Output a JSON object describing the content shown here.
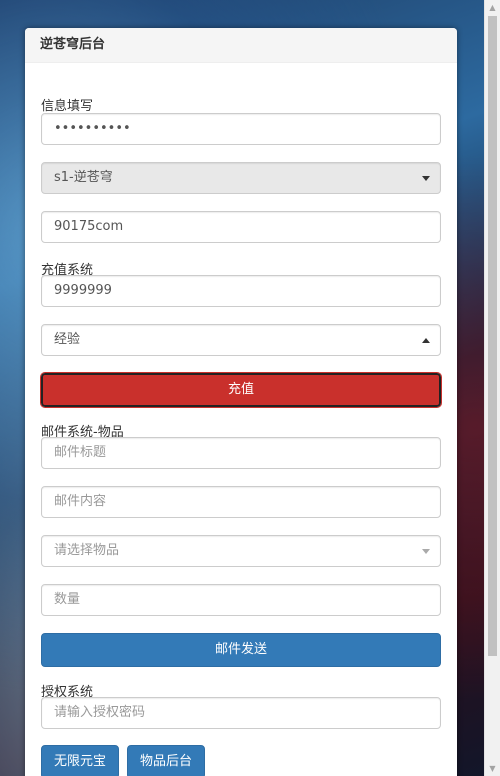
{
  "panel": {
    "title": "逆苍穹后台"
  },
  "info": {
    "label": "信息填写",
    "password_value": "••••••••••",
    "server_selected": "s1-逆苍穹",
    "account_value": "90175com"
  },
  "recharge": {
    "label": "充值系统",
    "amount_value": "9999999",
    "type_selected": "经验",
    "button_label": "充值"
  },
  "mail": {
    "label": "邮件系统-物品",
    "subject_placeholder": "邮件标题",
    "content_placeholder": "邮件内容",
    "item_placeholder": "请选择物品",
    "quantity_placeholder": "数量",
    "send_label": "邮件发送"
  },
  "auth": {
    "label": "授权系统",
    "password_placeholder": "请输入授权密码",
    "btn_unlimited": "无限元宝",
    "btn_items": "物品后台"
  },
  "colors": {
    "primary": "#337ab7",
    "danger": "#c9302c"
  }
}
